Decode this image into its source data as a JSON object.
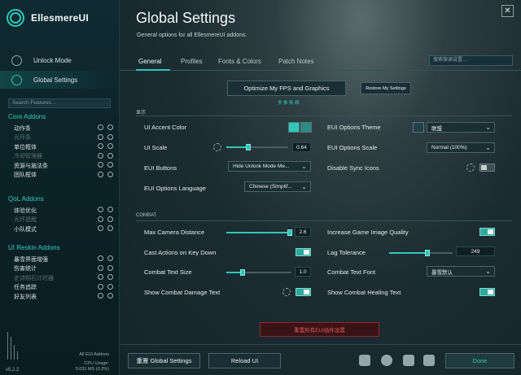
{
  "app": {
    "name": "EllesmereUI",
    "version": "v5.2.2"
  },
  "sidebar": {
    "nav": [
      {
        "label": "Unlock Mode",
        "icon": "unlock-icon"
      },
      {
        "label": "Global Settings",
        "icon": "globe-icon"
      }
    ],
    "search_placeholder": "Search Features...",
    "sections": [
      {
        "title": "Core Addons",
        "items": [
          {
            "label": "动作条",
            "enabled": true
          },
          {
            "label": "光环条",
            "enabled": false
          },
          {
            "label": "单位框体",
            "enabled": true
          },
          {
            "label": "冷却管理器",
            "enabled": false
          },
          {
            "label": "资源与施法条",
            "enabled": true
          },
          {
            "label": "团队框体",
            "enabled": true
          }
        ]
      },
      {
        "title": "QoL Addons",
        "items": [
          {
            "label": "体验优化",
            "enabled": true
          },
          {
            "label": "光环提醒",
            "enabled": false
          },
          {
            "label": "小队模式",
            "enabled": true
          }
        ]
      },
      {
        "title": "UI Reskin Addons",
        "items": [
          {
            "label": "暴雪界面增强",
            "enabled": true
          },
          {
            "label": "伤害统计",
            "enabled": true
          },
          {
            "label": "史诗钥石计时器",
            "enabled": false
          },
          {
            "label": "任务追踪",
            "enabled": true
          },
          {
            "label": "好友列表",
            "enabled": true
          }
        ]
      }
    ],
    "footer": {
      "all_addons": "All EUI Addons",
      "cpu_label": "CPU Usage:",
      "cpu_value": "0.031 MS (0.2%)"
    }
  },
  "header": {
    "title": "Global Settings",
    "subtitle": "General options for all EllesmereUI addons.",
    "search_placeholder": "搜索微调设置..."
  },
  "tabs": [
    {
      "label": "General",
      "active": true
    },
    {
      "label": "Profiles",
      "active": false
    },
    {
      "label": "Fonts & Colors",
      "active": false
    },
    {
      "label": "Patch Notes",
      "active": false
    }
  ],
  "top_actions": {
    "optimize_label": "Optimize My FPS and Graphics",
    "optimize_caption": "多 推 耗 释",
    "restore_label": "Restore My Settings"
  },
  "display_section": {
    "title": "显示",
    "rows": {
      "ui_accent_color": "UI Accent Color",
      "ui_scale": "UI Scale",
      "ui_scale_value": "0.64",
      "eui_buttons": "EUI Buttons",
      "eui_buttons_value": "Hide Unlock Mode Me...",
      "eui_options_language": "EUI Options Language",
      "eui_options_language_value": "Chinese (Simplif...",
      "eui_options_theme": "EUI Options Theme",
      "eui_options_theme_value": "联盟",
      "eui_options_scale": "EUI Options Scale",
      "eui_options_scale_value": "Normal (100%)",
      "disable_sync_icons": "Disable Sync Icons"
    },
    "accent_colors": [
      "#30c6b8",
      "#2d8a82"
    ],
    "theme_swatch": "#24404a",
    "ui_scale_fraction": 0.36,
    "disable_sync_icons_on": false
  },
  "combat_section": {
    "title": "COMBAT",
    "rows": {
      "max_camera_distance": "Max Camera Distance",
      "max_camera_distance_value": "2.6",
      "cast_on_key_down": "Cast Actions on Key Down",
      "combat_text_size": "Combat Text Size",
      "combat_text_size_value": "1.0",
      "show_combat_damage_text": "Show Combat Damage Text",
      "increase_game_image_quality": "Increase Game Image Quality",
      "lag_tolerance": "Lag Tolerance",
      "lag_tolerance_value": "249",
      "combat_text_font": "Combat Text Font",
      "combat_text_font_value": "暴雪默认",
      "show_combat_healing_text": "Show Combat Healing Text"
    },
    "max_camera_distance_fraction": 0.98,
    "combat_text_size_fraction": 0.25,
    "lag_tolerance_fraction": 0.6,
    "toggles": {
      "cast_on_key_down": true,
      "show_combat_damage_text": true,
      "increase_game_image_quality": true,
      "show_combat_healing_text": true
    }
  },
  "reset_all_label": "重置所有EUI插件设置",
  "footer": {
    "reset_global_label": "重置 Global Settings",
    "reload_label": "Reload UI",
    "done_label": "Done",
    "social_icons": [
      "twitch-icon",
      "discord-icon",
      "community-icon",
      "paypal-icon"
    ]
  },
  "colors": {
    "accent": "#30c6b8",
    "danger": "#e05a58"
  }
}
